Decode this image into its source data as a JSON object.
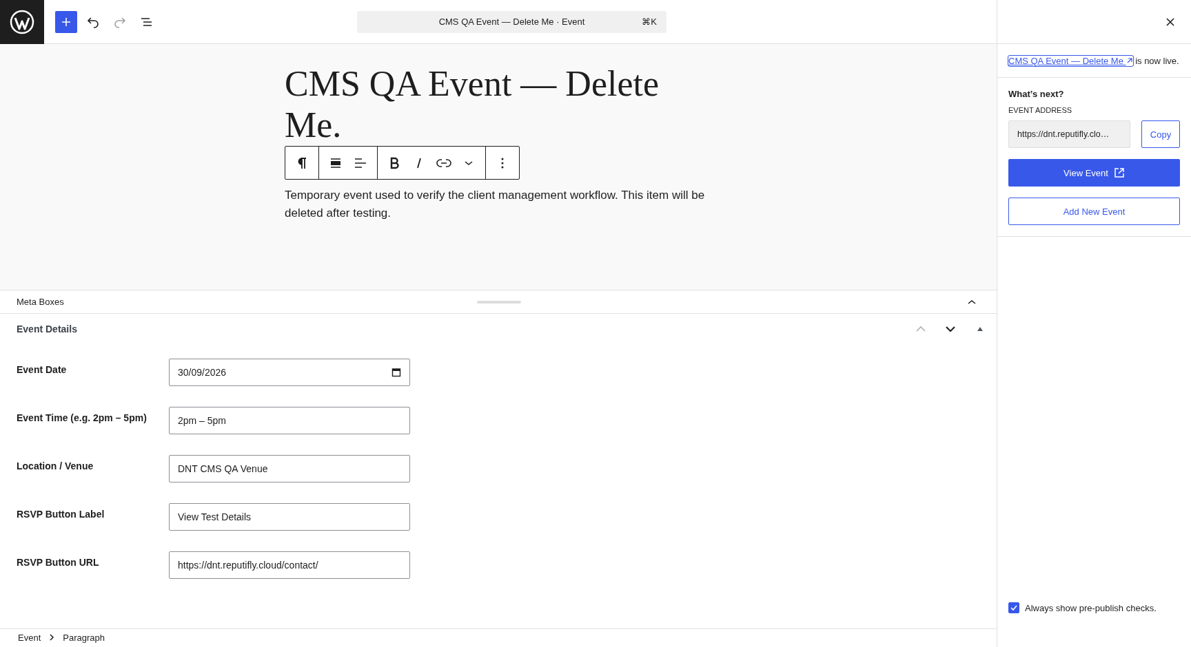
{
  "topbar": {
    "command_title": "CMS QA Event — Delete Me · Event",
    "shortcut": "⌘K",
    "redo_disabled": true
  },
  "editor": {
    "title": "CMS QA Event — Delete Me.",
    "paragraph": "Temporary event used to verify the client management workflow. This item will be deleted after testing."
  },
  "meta_boxes": {
    "title": "Meta Boxes",
    "expanded": true
  },
  "event_details": {
    "title": "Event Details",
    "move_up_disabled": true,
    "fields": [
      {
        "label": "Event Date",
        "value": "30/09/2026",
        "kind": "date"
      },
      {
        "label": "Event Time (e.g. 2pm – 5pm)",
        "value": "2pm – 5pm",
        "kind": "text"
      },
      {
        "label": "Location / Venue",
        "value": "DNT CMS QA Venue",
        "kind": "text"
      },
      {
        "label": "RSVP Button Label",
        "value": "View Test Details",
        "kind": "text"
      },
      {
        "label": "RSVP Button URL",
        "value": "https://dnt.reputifly.cloud/contact/",
        "kind": "text"
      }
    ]
  },
  "sidebar": {
    "link": "CMS QA Event — Delete Me",
    "notice": "is now live.",
    "heading": "What’s next?",
    "address_label": "EVENT ADDRESS",
    "address": "https://dnt.reputifly.clo…",
    "copy": "Copy",
    "view": "View Event",
    "add": "Add New Event",
    "always_show": {
      "label": "Always show pre-publish checks.",
      "checked": true
    }
  },
  "breadcrumb": [
    "Event",
    "Paragraph"
  ]
}
